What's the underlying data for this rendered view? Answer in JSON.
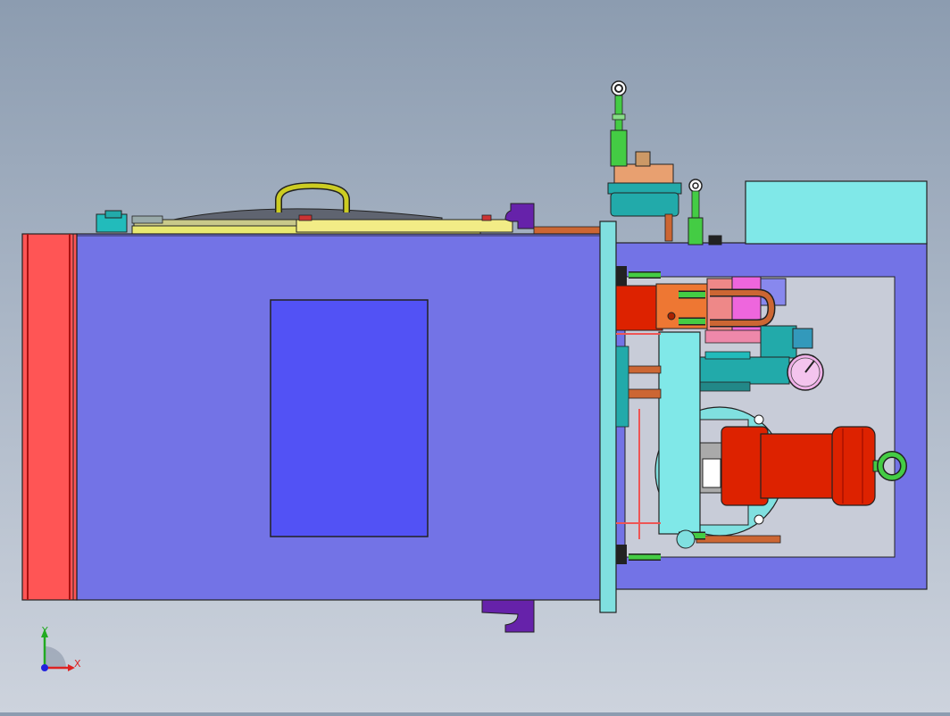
{
  "viewport": {
    "background_top": "#8c9cb0",
    "background_bottom": "#cdd3dd"
  },
  "model": {
    "colors": {
      "tank_body": "#7373e6",
      "tank_window": "#5252f5",
      "red_end_cap": "#ff5555",
      "cyan_plate": "#80e0e0",
      "motor_red": "#dd2200",
      "pipe_copper": "#cc6633",
      "fitting_green": "#44cc44",
      "bracket_purple": "#6622aa",
      "yellow_lid": "#e8e870",
      "teal_filter": "#22aaaa",
      "pink_valve": "#ee66dd",
      "orange_block": "#ee7733",
      "outline": "#222222"
    },
    "components": [
      "red-end-cap",
      "main-tank",
      "inspection-window",
      "tank-lid",
      "lid-handle",
      "mounting-bracket-top",
      "mounting-bracket-bottom",
      "flange-plate",
      "electrical-box",
      "frame-housing",
      "breather-filter",
      "level-gauge-rod",
      "valve-manifold",
      "pressure-gauge",
      "solenoid-valve",
      "pump-flange",
      "electric-motor",
      "lifting-eye",
      "copper-pipes",
      "hose-fittings"
    ]
  },
  "triad": {
    "x_label": "X",
    "y_label": "Y",
    "x_color": "#dd2222",
    "y_color": "#22aa22",
    "z_color": "#2222dd"
  }
}
